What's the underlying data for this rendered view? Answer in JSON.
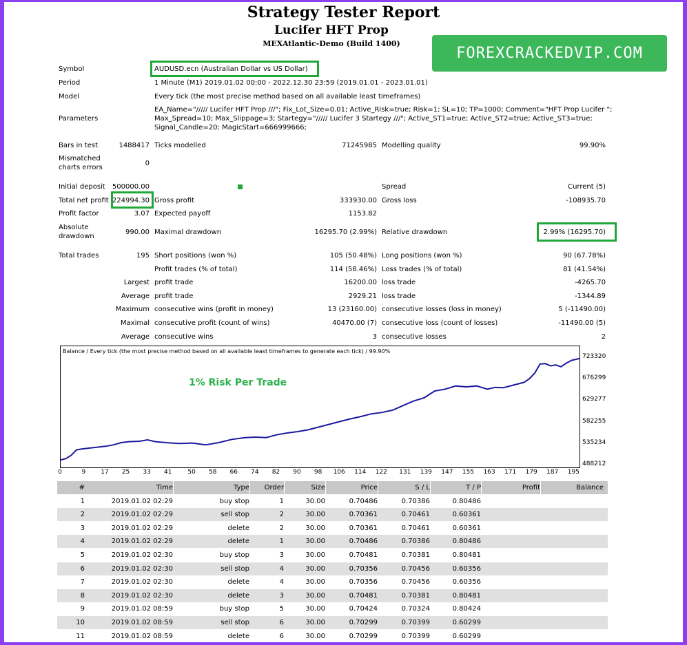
{
  "header": {
    "title": "Strategy Tester Report",
    "subtitle": "Lucifer HFT Prop",
    "build": "MEXAtlantic-Demo (Build 1400)",
    "brand": "FOREXCRACKEDVIP.COM"
  },
  "info": {
    "symbol_label": "Symbol",
    "symbol_value": "AUDUSD.ecn (Australian Dollar vs US Dollar)",
    "period_label": "Period",
    "period_value": "1 Minute (M1) 2019.01.02 00:00 - 2022.12.30 23:59 (2019.01.01 - 2023.01.01)",
    "model_label": "Model",
    "model_value": "Every tick (the most precise method based on all available least timeframes)",
    "parameters_label": "Parameters",
    "parameters_line1": "EA_Name=\"///// Lucifer HFT Prop ///\"; Fix_Lot_Size=0.01; Active_Risk=true; Risk=1; SL=10; TP=1000; Comment=\"HFT Prop Lucifer \";",
    "parameters_line2": "Max_Spread=10; Max_Slippage=3; Startegy=\"///// Lucifer 3 Startegy ///\"; Active_ST1=true; Active_ST2=true; Active_ST3=true;",
    "parameters_line3": "Signal_Candle=20; MagicStart=666999666;"
  },
  "stats": {
    "bars_label": "Bars in test",
    "bars_value": "1488417",
    "ticks_label": "Ticks modelled",
    "ticks_value": "71245985",
    "quality_label": "Modelling quality",
    "quality_value": "99.90%",
    "mismatch_label1": "Mismatched",
    "mismatch_label2": "charts errors",
    "mismatch_value": "0",
    "deposit_label": "Initial deposit",
    "deposit_value": "500000.00",
    "spread_label": "Spread",
    "spread_value": "Current (5)",
    "netprofit_label": "Total net profit",
    "netprofit_value": "224994.30",
    "grossprofit_label": "Gross profit",
    "grossprofit_value": "333930.00",
    "grossloss_label": "Gross loss",
    "grossloss_value": "-108935.70",
    "pf_label": "Profit factor",
    "pf_value": "3.07",
    "ep_label": "Expected payoff",
    "ep_value": "1153.82",
    "absdd_label1": "Absolute",
    "absdd_label2": "drawdown",
    "absdd_value": "990.00",
    "maxdd_label": "Maximal drawdown",
    "maxdd_value": "16295.70 (2.99%)",
    "reldd_label": "Relative drawdown",
    "reldd_value": "2.99% (16295.70)",
    "trades_label": "Total trades",
    "trades_value": "195",
    "short_label": "Short positions (won %)",
    "short_value": "105 (50.48%)",
    "long_label": "Long positions (won %)",
    "long_value": "90 (67.78%)",
    "ptrades_label": "Profit trades (% of total)",
    "ptrades_value": "114 (58.46%)",
    "ltrades_label": "Loss trades (% of total)",
    "ltrades_value": "81 (41.54%)",
    "largest_label": "Largest",
    "largest_pt_label": "profit trade",
    "largest_pt_value": "16200.00",
    "largest_lt_label": "loss trade",
    "largest_lt_value": "-4265.70",
    "average_label": "Average",
    "avg_pt_label": "profit trade",
    "avg_pt_value": "2929.21",
    "avg_lt_label": "loss trade",
    "avg_lt_value": "-1344.89",
    "maximum_label": "Maximum",
    "max_cw_label": "consecutive wins (profit in money)",
    "max_cw_value": "13 (23160.00)",
    "max_cl_label": "consecutive losses (loss in money)",
    "max_cl_value": "5 (-11490.00)",
    "maximal_label": "Maximal",
    "maxl_cp_label": "consecutive profit (count of wins)",
    "maxl_cp_value": "40470.00 (7)",
    "maxl_cl_label": "consecutive loss (count of losses)",
    "maxl_cl_value": "-11490.00 (5)",
    "average2_label": "Average",
    "avg_cw_label": "consecutive wins",
    "avg_cw_value": "3",
    "avg_cl_label": "consecutive losses",
    "avg_cl_value": "2"
  },
  "chart_data": {
    "type": "line",
    "title": "Balance / Every tick (the most precise method based on all available least timeframes to generate each tick) / 99.90%",
    "annotation": "1% Risk Per Trade",
    "x_ticks": [
      "0",
      "9",
      "17",
      "25",
      "33",
      "41",
      "50",
      "58",
      "66",
      "74",
      "82",
      "90",
      "98",
      "106",
      "114",
      "122",
      "131",
      "139",
      "147",
      "155",
      "163",
      "171",
      "179",
      "187",
      "195"
    ],
    "y_ticks": [
      "723320",
      "676299",
      "629277",
      "582255",
      "535234",
      "488212"
    ],
    "ylim": [
      488212,
      723320
    ],
    "xlim": [
      0,
      197
    ],
    "line_color": "#1a1aa0",
    "x": [
      0,
      2,
      4,
      6,
      8,
      11,
      14,
      17,
      20,
      23,
      26,
      30,
      33,
      36,
      40,
      45,
      50,
      55,
      60,
      65,
      70,
      74,
      78,
      82,
      86,
      90,
      94,
      98,
      102,
      106,
      110,
      114,
      118,
      122,
      126,
      130,
      134,
      138,
      142,
      146,
      150,
      154,
      158,
      162,
      165,
      168,
      172,
      176,
      178,
      180,
      182,
      184,
      186,
      188,
      190,
      192,
      194,
      197
    ],
    "y": [
      500000,
      503000,
      510000,
      522000,
      524000,
      526000,
      528000,
      530000,
      533000,
      538000,
      540000,
      541000,
      544000,
      540000,
      538000,
      536000,
      537000,
      533000,
      538000,
      545000,
      549000,
      550000,
      549000,
      555000,
      559000,
      562000,
      566000,
      572000,
      578000,
      584000,
      590000,
      595000,
      601000,
      604000,
      609000,
      619000,
      629000,
      636000,
      651000,
      655000,
      662000,
      660000,
      662000,
      655000,
      659000,
      658000,
      664000,
      670000,
      678000,
      690000,
      710000,
      711000,
      706000,
      708000,
      704000,
      712000,
      718000,
      722000
    ]
  },
  "trades": {
    "headers": [
      "#",
      "Time",
      "Type",
      "Order",
      "Size",
      "Price",
      "S / L",
      "T / P",
      "Profit",
      "Balance"
    ],
    "rows": [
      [
        "1",
        "2019.01.02 02:29",
        "buy stop",
        "1",
        "30.00",
        "0.70486",
        "0.70386",
        "0.80486",
        "",
        ""
      ],
      [
        "2",
        "2019.01.02 02:29",
        "sell stop",
        "2",
        "30.00",
        "0.70361",
        "0.70461",
        "0.60361",
        "",
        ""
      ],
      [
        "3",
        "2019.01.02 02:29",
        "delete",
        "2",
        "30.00",
        "0.70361",
        "0.70461",
        "0.60361",
        "",
        ""
      ],
      [
        "4",
        "2019.01.02 02:29",
        "delete",
        "1",
        "30.00",
        "0.70486",
        "0.70386",
        "0.80486",
        "",
        ""
      ],
      [
        "5",
        "2019.01.02 02:30",
        "buy stop",
        "3",
        "30.00",
        "0.70481",
        "0.70381",
        "0.80481",
        "",
        ""
      ],
      [
        "6",
        "2019.01.02 02:30",
        "sell stop",
        "4",
        "30.00",
        "0.70356",
        "0.70456",
        "0.60356",
        "",
        ""
      ],
      [
        "7",
        "2019.01.02 02:30",
        "delete",
        "4",
        "30.00",
        "0.70356",
        "0.70456",
        "0.60356",
        "",
        ""
      ],
      [
        "8",
        "2019.01.02 02:30",
        "delete",
        "3",
        "30.00",
        "0.70481",
        "0.70381",
        "0.80481",
        "",
        ""
      ],
      [
        "9",
        "2019.01.02 08:59",
        "buy stop",
        "5",
        "30.00",
        "0.70424",
        "0.70324",
        "0.80424",
        "",
        ""
      ],
      [
        "10",
        "2019.01.02 08:59",
        "sell stop",
        "6",
        "30.00",
        "0.70299",
        "0.70399",
        "0.60299",
        "",
        ""
      ],
      [
        "11",
        "2019.01.02 08:59",
        "delete",
        "6",
        "30.00",
        "0.70299",
        "0.70399",
        "0.60299",
        "",
        ""
      ]
    ]
  }
}
